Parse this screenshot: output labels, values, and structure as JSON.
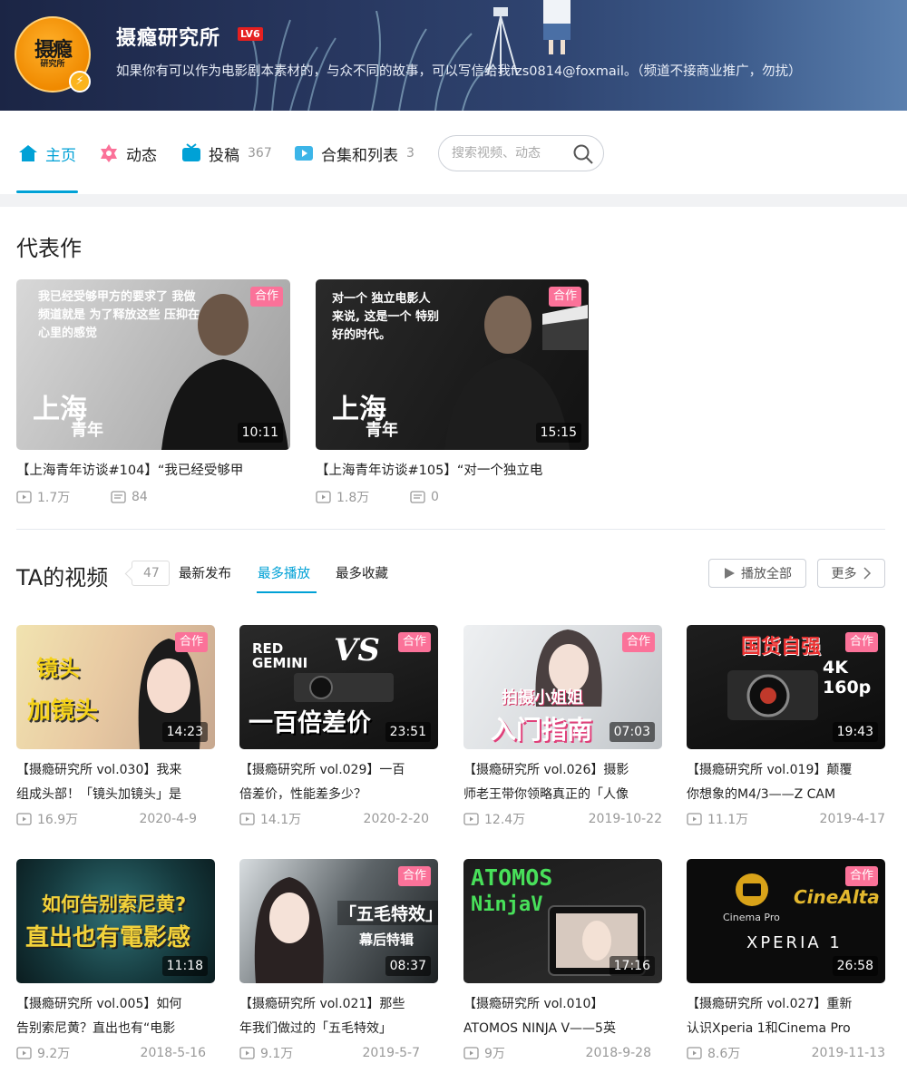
{
  "header": {
    "username": "摄瘾研究所",
    "level": "LV6",
    "bio": "如果你有可以作为电影剧本素材的，与众不同的故事，可以写信给我fzs0814@foxmail。（频道不接商业推广，勿扰）",
    "avatar_text": "摄瘾",
    "avatar_sub": "研究所"
  },
  "nav": {
    "home": "主页",
    "dynamic": "动态",
    "submit": "投稿",
    "submit_count": "367",
    "collections": "合集和列表",
    "collections_count": "3",
    "search_placeholder": "搜索视频、动态"
  },
  "featured": {
    "title": "代表作",
    "items": [
      {
        "title": "【上海青年访谈#104】“我已经受够甲",
        "views": "1.7万",
        "comments": "84",
        "duration": "10:11",
        "badge": "合作",
        "quote": "我已经受够甲方的要求了 我做频道就是 为了释放这些 压抑在心里的感觉",
        "city": "上海",
        "youth": "青年"
      },
      {
        "title": "【上海青年访谈#105】“对一个独立电",
        "views": "1.8万",
        "comments": "0",
        "duration": "15:15",
        "badge": "合作",
        "quote": "对一个 独立电影人来说, 这是一个 特别好的时代。",
        "city": "上海",
        "youth": "青年"
      }
    ]
  },
  "videos": {
    "title": "TA的视频",
    "count": "47",
    "tabs": [
      "最新发布",
      "最多播放",
      "最多收藏"
    ],
    "active_tab": "最多播放",
    "play_all": "播放全部",
    "more": "更多",
    "items": [
      {
        "line1": "【摄瘾研究所 vol.030】我来",
        "line2": "组成头部！「镜头加镜头」是",
        "views": "16.9万",
        "date": "2020-4-9",
        "duration": "14:23",
        "badge": "合作",
        "art1": "镜头",
        "art2": "加镜头"
      },
      {
        "line1": "【摄瘾研究所 vol.029】一百",
        "line2": "倍差价，性能差多少？",
        "views": "14.1万",
        "date": "2020-2-20",
        "duration": "23:51",
        "badge": "合作",
        "art1": "RED GEMINI",
        "art2": "一百倍差价"
      },
      {
        "line1": "【摄瘾研究所 vol.026】摄影",
        "line2": "师老王带你领略真正的「人像",
        "views": "12.4万",
        "date": "2019-10-22",
        "duration": "07:03",
        "badge": "合作",
        "art1": "拍摄小姐姐",
        "art2": "入门指南"
      },
      {
        "line1": "【摄瘾研究所 vol.019】颠覆",
        "line2": "你想象的M4/3——Z CAM",
        "views": "11.1万",
        "date": "2019-4-17",
        "duration": "19:43",
        "badge": "合作",
        "art1": "国货自强",
        "art2": "4K 160p"
      },
      {
        "line1": "【摄瘾研究所 vol.005】如何",
        "line2": "告别索尼黄？直出也有“电影",
        "views": "9.2万",
        "date": "2018-5-16",
        "duration": "11:18",
        "badge": "",
        "art1": "如何告别索尼黄?",
        "art2": "直出也有電影感"
      },
      {
        "line1": "【摄瘾研究所 vol.021】那些",
        "line2": "年我们做过的「五毛特效」",
        "views": "9.1万",
        "date": "2019-5-7",
        "duration": "08:37",
        "badge": "合作",
        "art1": "「五毛特效」",
        "art2": "幕后特辑"
      },
      {
        "line1": "【摄瘾研究所 vol.010】",
        "line2": "ATOMOS NINJA V——5英",
        "views": "9万",
        "date": "2018-9-28",
        "duration": "17:16",
        "badge": "",
        "art1": "ATOMOS",
        "art2": "NinjaV"
      },
      {
        "line1": "【摄瘾研究所 vol.027】重新",
        "line2": "认识Xperia 1和Cinema Pro",
        "views": "8.6万",
        "date": "2019-11-13",
        "duration": "26:58",
        "badge": "合作",
        "art1": "XPERIA 1",
        "art2": "CineAlta"
      }
    ]
  }
}
